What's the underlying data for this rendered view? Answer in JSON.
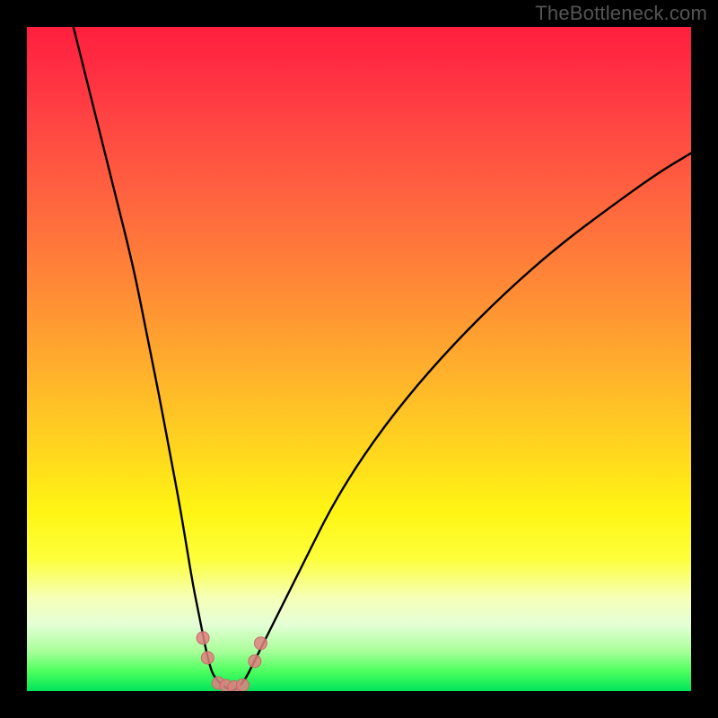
{
  "watermark": "TheBottleneck.com",
  "chart_data": {
    "type": "line",
    "title": "",
    "xlabel": "",
    "ylabel": "",
    "xlim": [
      0,
      100
    ],
    "ylim": [
      0,
      100
    ],
    "grid": false,
    "series": [
      {
        "name": "left-curve",
        "x": [
          7,
          10,
          13,
          16,
          18,
          20,
          21.5,
          23,
          24,
          25,
          25.8,
          26.4,
          27,
          27.5,
          28,
          29,
          30,
          31
        ],
        "y": [
          100,
          88,
          76,
          64,
          54,
          44,
          36,
          28,
          22,
          16,
          12,
          9,
          6,
          4,
          2.5,
          1.2,
          0.5,
          0
        ]
      },
      {
        "name": "right-curve",
        "x": [
          31,
          32,
          33,
          34,
          35.5,
          37,
          39,
          42,
          46,
          51,
          57,
          64,
          72,
          80,
          88,
          95,
          100
        ],
        "y": [
          0,
          0.7,
          2,
          4,
          7,
          10,
          14,
          20,
          28,
          36,
          44,
          52,
          60,
          67,
          73,
          78,
          81
        ]
      }
    ],
    "markers": [
      {
        "name": "left-dip-marker-1",
        "x": 26.5,
        "y": 8
      },
      {
        "name": "left-dip-marker-2",
        "x": 27.2,
        "y": 5
      },
      {
        "name": "floor-marker-1",
        "x": 28.8,
        "y": 1.2
      },
      {
        "name": "floor-marker-2",
        "x": 30.0,
        "y": 0.8
      },
      {
        "name": "floor-marker-3",
        "x": 31.2,
        "y": 0.6
      },
      {
        "name": "floor-marker-4",
        "x": 32.5,
        "y": 0.9
      },
      {
        "name": "right-dip-marker-1",
        "x": 34.3,
        "y": 4.5
      },
      {
        "name": "right-dip-marker-2",
        "x": 35.2,
        "y": 7.2
      }
    ],
    "background_gradient": {
      "top": "#ff1f3e",
      "mid_upper": "#ff8c35",
      "mid": "#fff514",
      "mid_lower": "#f6ffb8",
      "bottom": "#00e45a"
    }
  }
}
